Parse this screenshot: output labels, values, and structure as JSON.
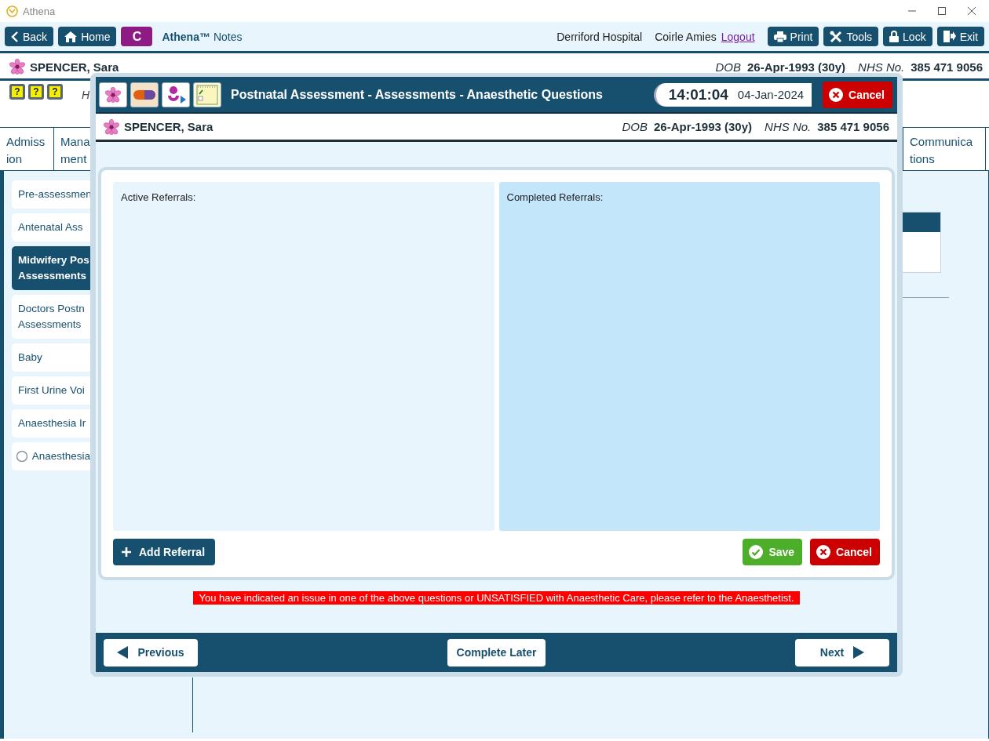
{
  "window": {
    "title": "Athena"
  },
  "toolbar": {
    "nav": [
      {
        "label": "Back",
        "kind": "back"
      },
      {
        "label": "Home",
        "kind": "home"
      }
    ],
    "user_badge": "C",
    "app_name": "Athena™",
    "app_suffix": "Notes",
    "hospital": "Derriford Hospital",
    "user": "Coirle Amies",
    "logout": "Logout",
    "actions": [
      {
        "label": "Print",
        "kind": "print"
      },
      {
        "label": "Tools",
        "kind": "tools"
      },
      {
        "label": "Lock",
        "kind": "lock"
      },
      {
        "label": "Exit",
        "kind": "exit"
      }
    ]
  },
  "patient": {
    "name": "SPENCER, Sara",
    "dob_label": "DOB",
    "dob": "26-Apr-1993 (30y)",
    "nhs_label": "NHS No.",
    "nhs": "385 471 9056"
  },
  "help_icons": [
    "?",
    "?",
    "?"
  ],
  "header_text": "H",
  "tabs": [
    {
      "lines": [
        "Admiss",
        "ion"
      ],
      "selected": false
    },
    {
      "lines": [
        "Mana",
        "ment"
      ],
      "selected": false
    },
    {
      "lines": [
        "Communica",
        "tions"
      ],
      "selected": false
    }
  ],
  "sidebar": {
    "items": [
      {
        "lines": [
          "Pre-assessmen"
        ],
        "kind": "link",
        "selected": false
      },
      {
        "lines": [
          "Antenatal Ass"
        ],
        "kind": "link",
        "selected": false
      },
      {
        "lines": [
          "Midwifery Pos",
          "Assessments"
        ],
        "kind": "link",
        "selected": true
      },
      {
        "lines": [
          "Doctors Postn",
          "Assessments"
        ],
        "kind": "link",
        "selected": false
      },
      {
        "lines": [
          "Baby"
        ],
        "kind": "link",
        "selected": false
      },
      {
        "lines": [
          "First Urine Voi"
        ],
        "kind": "link",
        "selected": false
      },
      {
        "lines": [
          "Anaesthesia Ir"
        ],
        "kind": "link",
        "selected": false
      },
      {
        "lines": [
          "Anaesthesia"
        ],
        "kind": "radio",
        "selected": false
      }
    ]
  },
  "dialog": {
    "title": "Postnatal Assessment - Assessments - Anaesthetic Questions",
    "time": "14:01:04",
    "date": "04-Jan-2024",
    "cancel": "Cancel",
    "patient": {
      "name": "SPENCER, Sara",
      "dob_label": "DOB",
      "dob": "26-Apr-1993 (30y)",
      "nhs_label": "NHS No.",
      "nhs": "385 471 9056"
    },
    "panels": [
      {
        "label": "Active Referrals:",
        "kind": "active"
      },
      {
        "label": "Completed Referrals:",
        "kind": "completed"
      }
    ],
    "add_button": "Add Referral",
    "save_button": "Save",
    "cancel_button": "Cancel",
    "warning": "You have indicated an issue in one of the above questions or UNSATISFIED with Anaesthetic Care, please refer to the Anaesthetist.",
    "footer": {
      "previous": "Previous",
      "complete_later": "Complete Later",
      "next": "Next"
    }
  }
}
